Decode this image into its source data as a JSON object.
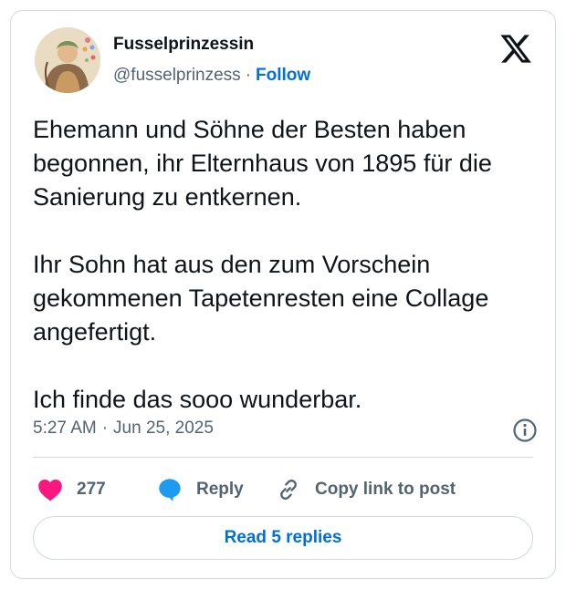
{
  "user": {
    "display_name": "Fusselprinzessin",
    "handle": "@fusselprinzess",
    "separator": "·",
    "follow_label": "Follow"
  },
  "post": {
    "paragraphs": [
      "Ehemann und Söhne der Besten haben begonnen, ihr Elternhaus von 1895 für die Sanierung zu entkernen.",
      "Ihr Sohn hat aus den zum Vorschein gekommenen Tapetenresten eine Collage angefertigt.",
      "Ich finde das sooo wunderbar."
    ],
    "time": "5:27 AM",
    "date_separator": "·",
    "date": "Jun 25, 2025"
  },
  "actions": {
    "like_count": "277",
    "reply_label": "Reply",
    "copy_label": "Copy link to post"
  },
  "footer": {
    "read_replies_label": "Read 5 replies"
  },
  "colors": {
    "accent": "#006fd6",
    "like": "#f91880",
    "reply_icon": "#1d9bf0",
    "muted": "#536471",
    "border": "#cfd9de"
  },
  "icons": {
    "brand": "x-logo-icon",
    "info": "info-icon",
    "like": "heart-icon",
    "reply": "speech-bubble-icon",
    "copy": "link-icon"
  }
}
